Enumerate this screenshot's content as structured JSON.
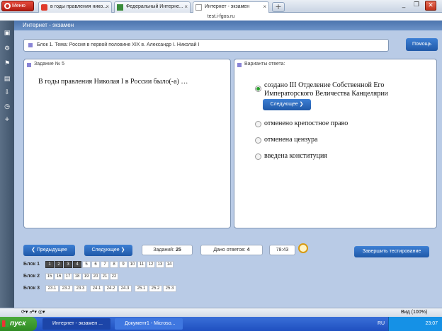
{
  "browser": {
    "menu_label": "Меню",
    "tabs": [
      {
        "title": "в годы правления нико..."
      },
      {
        "title": "Федеральный Интерне..."
      },
      {
        "title": "Интернет - экзамен"
      }
    ],
    "new_tab_label": "+",
    "address": "test.i-fgos.ru"
  },
  "page": {
    "header": "Интернет - экзамен",
    "topic": "Блок 1. Тема: Россия в первой половине XIX в. Александр I. Николай I",
    "help_label": "Помощь",
    "question_panel_title": "Задание № 5",
    "question_text": "В годы правления Николая I в России было(-а) …",
    "answers_panel_title": "Варианты ответа:",
    "options": [
      {
        "text_line1": "создано III Отделение Собственной Его",
        "text_line2": "Императорского Величества Канцелярии",
        "selected": true
      },
      {
        "text_line1": "отменено крепостное право",
        "selected": false
      },
      {
        "text_line1": "отменена цензура",
        "selected": false
      },
      {
        "text_line1": "введена конституция",
        "selected": false
      }
    ],
    "next_inline_label": "Следующее ❯",
    "prev_label": "❮ Предыдущее",
    "next_label": "Следующее ❯",
    "tasks_label": "Заданий:",
    "tasks_count": "25",
    "answered_label": "Дано ответов:",
    "answered_count": "4",
    "timer": "78:43",
    "finish_label": "Завершить тестирование",
    "blocks": [
      {
        "label": "Блок 1",
        "cells": [
          "1",
          "2",
          "3",
          "4",
          "5",
          "6",
          "7",
          "8",
          "9",
          "10",
          "11",
          "12",
          "13",
          "14"
        ],
        "done": 4
      },
      {
        "label": "Блок 2",
        "cells": [
          "15",
          "16",
          "17",
          "18",
          "19",
          "20",
          "21",
          "22"
        ],
        "done": 0
      },
      {
        "label": "Блок 3",
        "cells": [
          "23.1",
          "23.2",
          "23.3",
          "24.1",
          "24.2",
          "24.3",
          "25.1",
          "25.2",
          "25.3"
        ],
        "done": 0
      }
    ]
  },
  "statusbar": {
    "zoom": "Вид (100%)"
  },
  "taskbar": {
    "start_label": "пуск",
    "tasks": [
      "Интернет - экзамен ...",
      "Документ1 - Microso..."
    ],
    "lang": "RU",
    "time": "23:07"
  }
}
